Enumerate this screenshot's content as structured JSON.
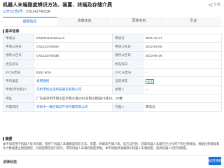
{
  "header": {
    "title": "机器人末端刚度辨识方法、装置、终端及存储介质",
    "share_label": "分享",
    "pub_number_label": "公开(公告)号:",
    "pub_number_value": "CN114274093A"
  },
  "tabs": [
    {
      "label": "基础信息",
      "count": ""
    },
    {
      "label": "法律状态",
      "count": ""
    },
    {
      "label": "同族专利",
      "count": ""
    },
    {
      "label": "引证",
      "count": ""
    }
  ],
  "section_title": "基本信息",
  "table": {
    "rows": [
      [
        {
          "k": "申请号",
          "v": "CN202111542xxx.X"
        },
        {
          "k": "申请日",
          "v": "2021-12-17"
        }
      ],
      [
        {
          "k": "申请公布号",
          "v": "CN114274093A"
        },
        {
          "k": "申请公布日",
          "v": "2022-04-05"
        }
      ],
      [
        {
          "k": "授权公告号",
          "v": "CN114274093B"
        },
        {
          "k": "授权公告日",
          "v": "2023-05-26"
        }
      ],
      [
        {
          "k": "优先权号",
          "v": "-"
        },
        {
          "k": "优先权日",
          "v": "-"
        }
      ],
      [
        {
          "k": "IPC分类号",
          "v": "B25J 9/16"
        },
        {
          "k": "CPC分类号",
          "v": "-"
        }
      ],
      [
        {
          "k": "专利类型",
          "v": "发明授权",
          "blue": true
        },
        {
          "k": "当前状态",
          "v": "有效",
          "badge": true
        }
      ],
      [
        {
          "k": "申请(专利权)人",
          "v": "深圳市优必选科技股份有限公司",
          "blue": true
        },
        {
          "k": "发明人",
          "v": "—"
        }
      ],
      [
        {
          "k": "地址",
          "v": "广东省深圳市南山区学苑大道1001号南山智园C1栋16、22楼",
          "span": true
        }
      ],
      [
        {
          "k": "代理机构",
          "v": "深圳中一联合知识产权代理有限公司",
          "blue": true
        },
        {
          "k": "代理人",
          "v": "黄志云"
        }
      ]
    ]
  },
  "abstract_title": "摘要",
  "abstract_text": "本申请适用于机器人技术领域，提供了机器人末端刚度辨识方法、装置、终端及存储介质。该方法包括：获取机器人末端在外力作用下的位移数据，根据位移数据和外力数据建立刚度模型，对刚度模型进行辨识，得到机器人末端的刚度参数。本申请能够准确辨识机器人末端刚度，提高机器人的控制精度。",
  "footer": {
    "label": "法律状态",
    "back_top": "返回顶部"
  }
}
